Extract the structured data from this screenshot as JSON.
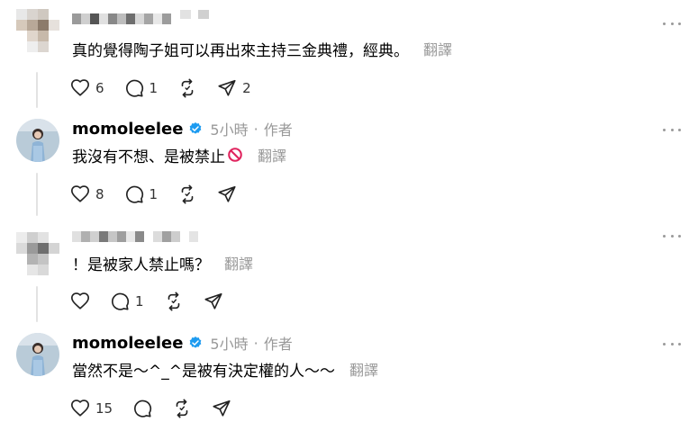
{
  "posts": [
    {
      "author_blurred": true,
      "text": "真的覺得陶子姐可以再出來主持三金典禮，經典。",
      "translate": "翻譯",
      "likes": "6",
      "replies": "1",
      "shares": "2"
    },
    {
      "author": "momoleelee",
      "time": "5小時",
      "role": "作者",
      "text": "我沒有不想、是被禁止",
      "emoji": "no-entry-emoji",
      "translate": "翻譯",
      "likes": "8",
      "replies": "1"
    },
    {
      "author_blurred": true,
      "text": "！是被家人禁止嗎？",
      "translate": "翻譯",
      "replies": "1"
    },
    {
      "author": "momoleelee",
      "time": "5小時",
      "role": "作者",
      "text": "當然不是～^_^是被有決定權的人～～",
      "translate": "翻譯",
      "likes": "15"
    }
  ],
  "meta_separator": "·",
  "colors": {
    "verified": "#1d9bf0",
    "ban": "#e0245e",
    "muted": "#999999",
    "line": "#e3e3e3"
  },
  "icons": [
    "heart-icon",
    "comment-icon",
    "repost-icon",
    "share-icon",
    "more-icon",
    "verified-badge-icon"
  ]
}
